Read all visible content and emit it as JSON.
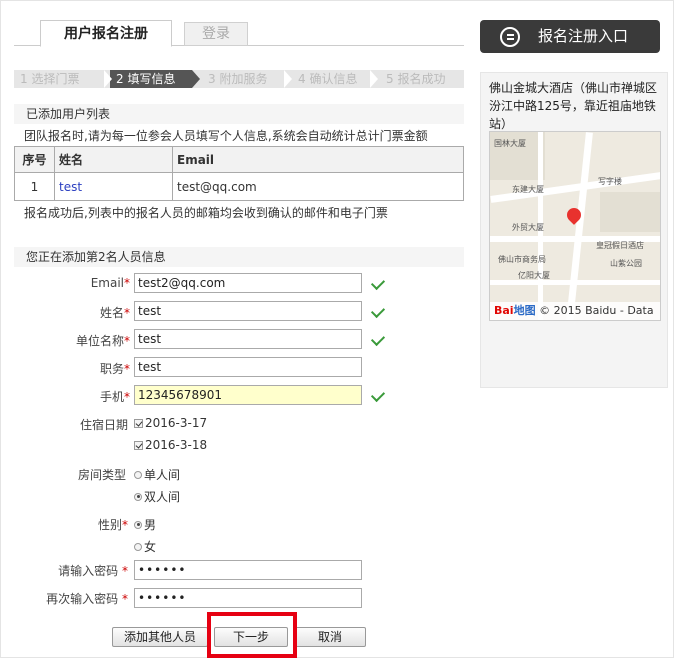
{
  "tabs": {
    "active": "用户报名注册",
    "inactive": "登录"
  },
  "steps": [
    "1 选择门票",
    "2 填写信息",
    "3 附加服务",
    "4 确认信息",
    "5 报名成功"
  ],
  "added_users": {
    "title": "已添加用户列表",
    "note": "团队报名时,请为每一位参会人员填写个人信息,系统会自动统计总计门票金额",
    "headers": [
      "序号",
      "姓名",
      "Email"
    ],
    "rows": [
      {
        "index": "1",
        "name": "test",
        "email": "test@qq.com"
      }
    ],
    "after_note": "报名成功后,列表中的报名人员的邮箱均会收到确认的邮件和电子门票"
  },
  "form": {
    "title": "您正在添加第2名人员信息",
    "email_label": "Email",
    "email_value": "test2@qq.com",
    "name_label": "姓名",
    "name_value": "test",
    "company_label": "单位名称",
    "company_value": "test",
    "position_label": "职务",
    "position_value": "test",
    "mobile_label": "手机",
    "mobile_value": "12345678901",
    "stay_label": "住宿日期",
    "stay_dates": [
      "2016-3-17",
      "2016-3-18"
    ],
    "room_label": "房间类型",
    "room_options": [
      "单人间",
      "双人间"
    ],
    "gender_label": "性别",
    "gender_options": [
      "男",
      "女"
    ],
    "password_label": "请输入密码",
    "password_value": "••••••",
    "password2_label": "再次输入密码",
    "password2_value": "••••••",
    "required_mark": "*"
  },
  "buttons": {
    "add_other": "添加其他人员",
    "next": "下一步",
    "cancel": "取消"
  },
  "sidebar": {
    "entry_label": "报名注册入口",
    "hotel": "佛山金城大酒店（佛山市禅城区汾江中路125号，靠近祖庙地铁站）",
    "map_copyright": "© 2015 Baidu - Data",
    "map_logo_a": "Bai",
    "map_logo_b": "地图",
    "map_labels": [
      "国林大厦",
      "东建大厦",
      "写字楼",
      "外贸大厦",
      "皇冠假日酒店",
      "佛山市商务局",
      "山紫公园",
      "亿阳大厦"
    ]
  },
  "colors": {
    "accent_red": "#e60012",
    "dark_button": "#3a3a3a",
    "check_green": "#3a9a3a",
    "highlight": "#ffffcc"
  }
}
